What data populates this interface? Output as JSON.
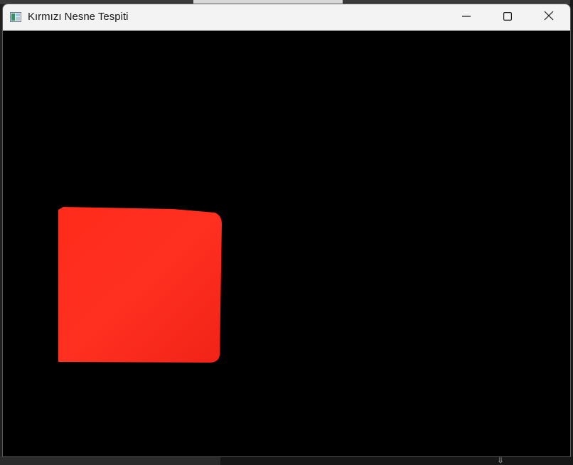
{
  "window": {
    "title": "Kırmızı Nesne Tespiti"
  },
  "controls": {
    "minimize": "minimize",
    "maximize": "maximize",
    "close": "close"
  },
  "colors": {
    "object_red": "#ff2a1a",
    "background": "#000000",
    "titlebar": "#f3f3f3"
  },
  "icons": {
    "app": "image-window-icon",
    "minimize": "minimize-icon",
    "maximize": "maximize-icon",
    "close": "close-icon"
  }
}
